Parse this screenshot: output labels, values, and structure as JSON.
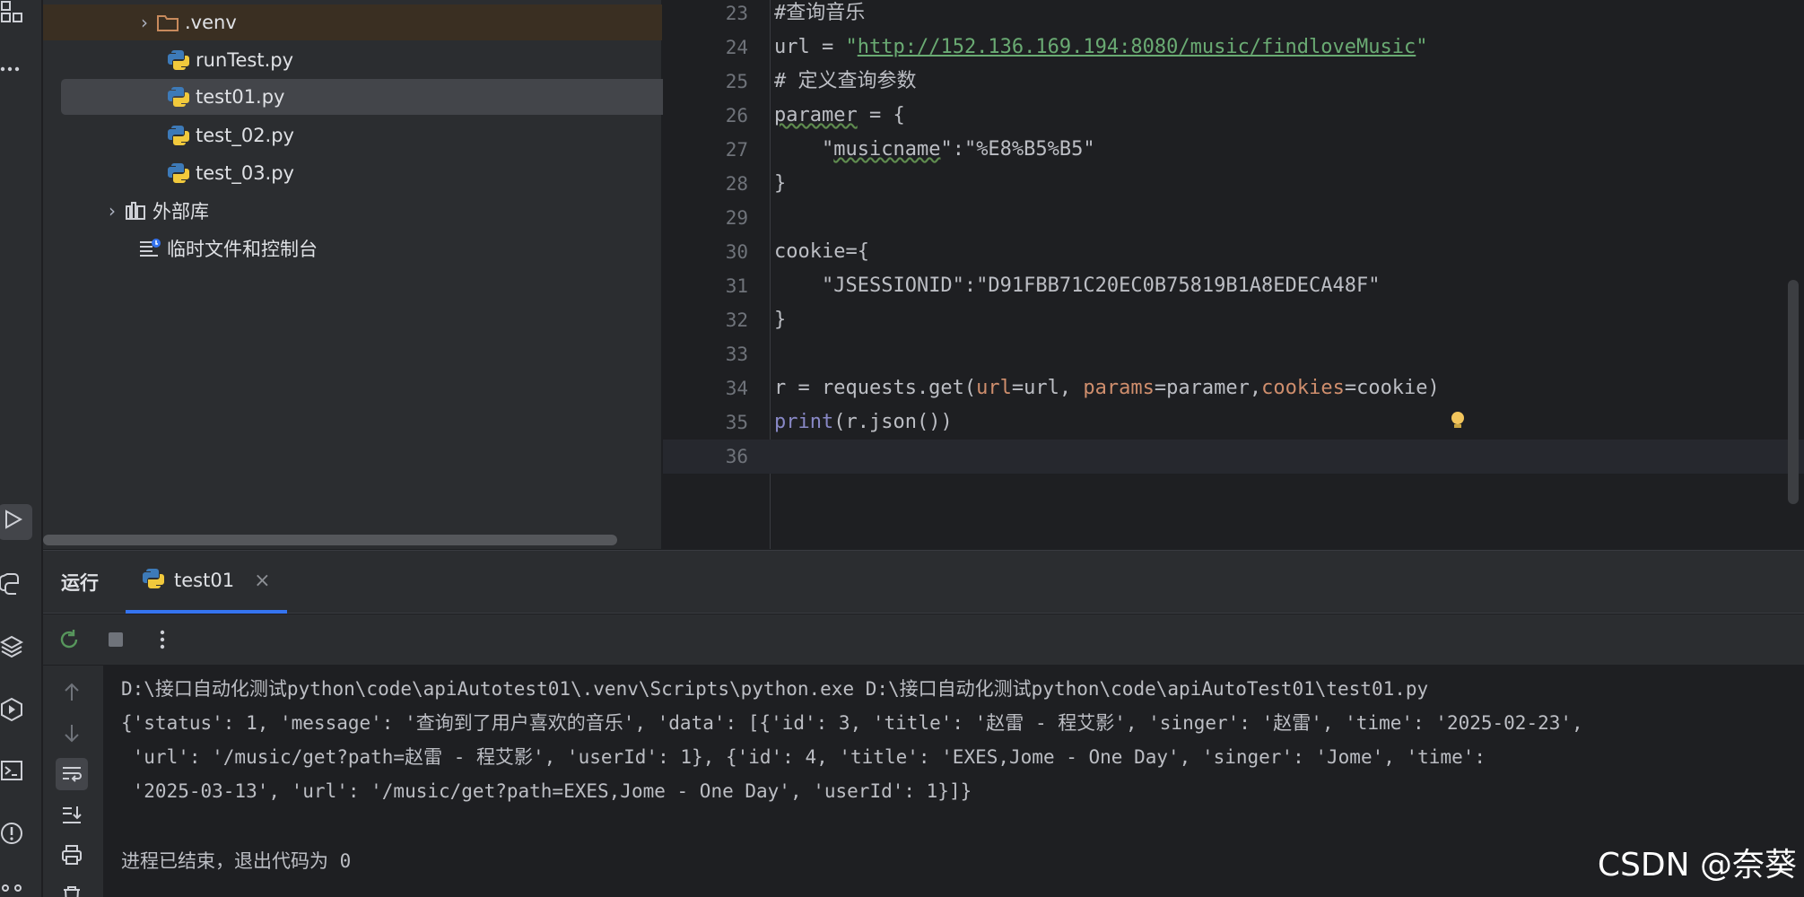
{
  "project_tree": {
    "venv": ".venv",
    "files": [
      "runTest.py",
      "test01.py",
      "test_02.py",
      "test_03.py"
    ],
    "external_libraries": "外部库",
    "scratches": "临时文件和控制台"
  },
  "editor": {
    "lines": [
      {
        "num": "23"
      },
      {
        "num": "24"
      },
      {
        "num": "25"
      },
      {
        "num": "26"
      },
      {
        "num": "27"
      },
      {
        "num": "28"
      },
      {
        "num": "29"
      },
      {
        "num": "30"
      },
      {
        "num": "31"
      },
      {
        "num": "32"
      },
      {
        "num": "33"
      },
      {
        "num": "34"
      },
      {
        "num": "35"
      },
      {
        "num": "36"
      }
    ],
    "code": {
      "l23": "#查询音乐",
      "l24_var": "url = ",
      "l24_q1": "\"",
      "l24_url": "http://152.136.169.194:8080/music/findloveMusic",
      "l24_q2": "\"",
      "l25": "# 定义查询参数",
      "l26_var": "paramer",
      "l26_rest": " = {",
      "l27_indent": "    ",
      "l27_q": "\"",
      "l27_key": "musicname",
      "l27_rest": "\":\"%E8%B5%B5\"",
      "l28": "}",
      "l30": "cookie={",
      "l31_indent": "    ",
      "l31_str": "\"JSESSIONID\":\"D91FBB71C20EC0B75819B1A8EDECA48F\"",
      "l32": "}",
      "l34_a": "r = requests.get(",
      "l34_k1": "url",
      "l34_b": "=url, ",
      "l34_k2": "params",
      "l34_c": "=paramer,",
      "l34_k3": "cookies",
      "l34_d": "=cookie)",
      "l35_fn": "print",
      "l35_rest": "(r.json())"
    }
  },
  "run": {
    "title": "运行",
    "tab_label": "test01",
    "console": [
      "D:\\接口自动化测试python\\code\\apiAutotest01\\.venv\\Scripts\\python.exe D:\\接口自动化测试python\\code\\apiAutoTest01\\test01.py",
      "{'status': 1, 'message': '查询到了用户喜欢的音乐', 'data': [{'id': 3, 'title': '赵雷 - 程艾影', 'singer': '赵雷', 'time': '2025-02-23',",
      " 'url': '/music/get?path=赵雷 - 程艾影', 'userId': 1}, {'id': 4, 'title': 'EXES,Jome - One Day', 'singer': 'Jome', 'time':",
      " '2025-03-13', 'url': '/music/get?path=EXES,Jome - One Day', 'userId': 1}]}",
      "进程已结束，退出代码为 0"
    ]
  },
  "watermark": "CSDN @奈葵"
}
